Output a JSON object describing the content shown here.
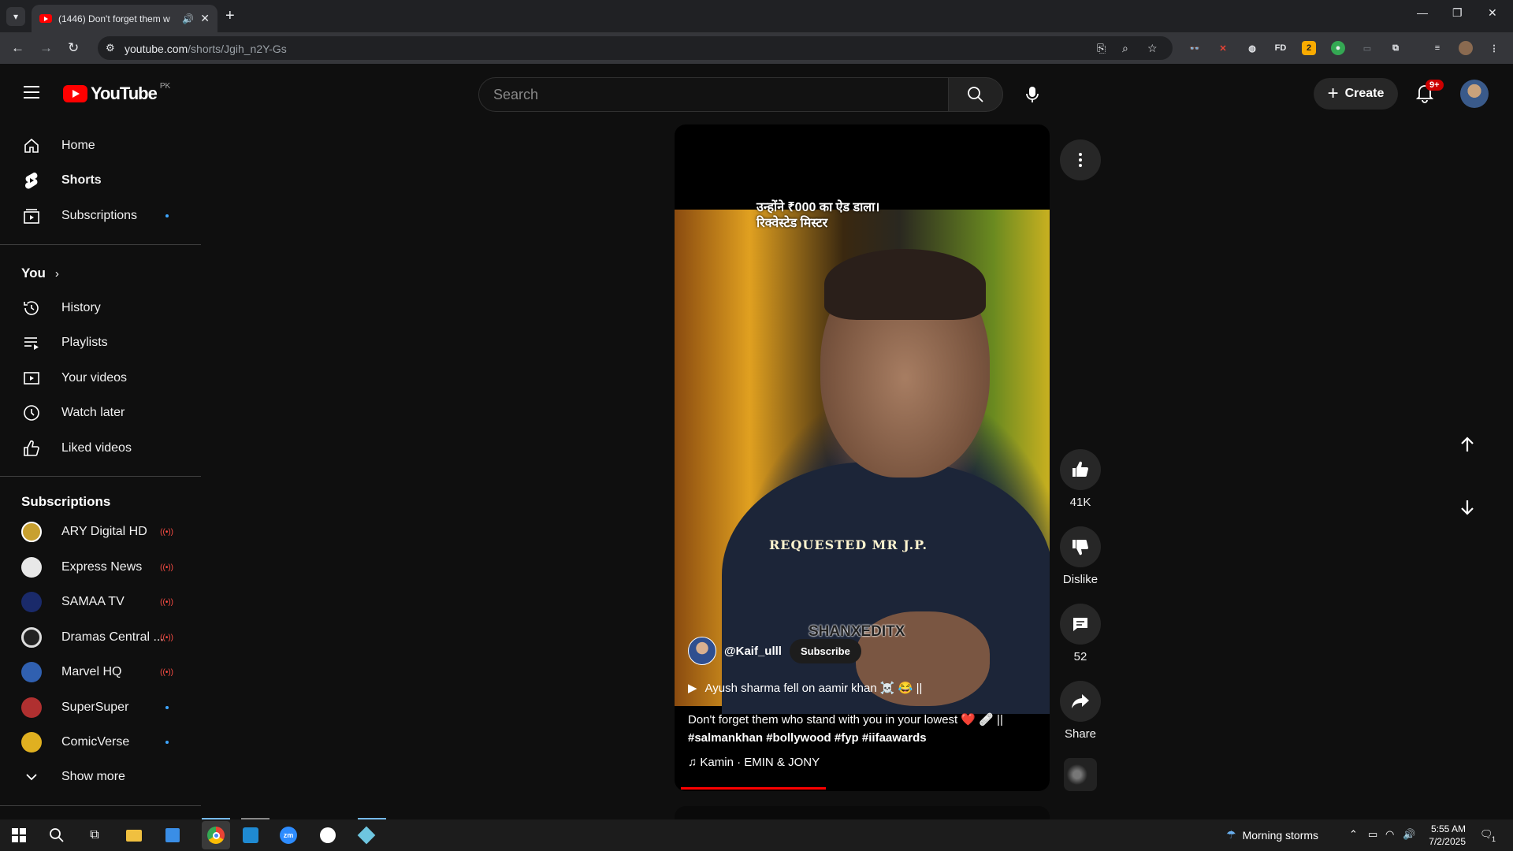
{
  "browser": {
    "tab_title": "(1446) Don't forget them w",
    "url_host": "youtube.com",
    "url_path": "/shorts/Jgih_n2Y-Gs"
  },
  "header": {
    "logo_text": "YouTube",
    "country_code": "PK",
    "search_placeholder": "Search",
    "create_label": "Create",
    "notification_count": "9+"
  },
  "sidebar": {
    "main": [
      {
        "label": "Home",
        "icon": "home-icon"
      },
      {
        "label": "Shorts",
        "icon": "shorts-icon"
      },
      {
        "label": "Subscriptions",
        "icon": "subscriptions-icon"
      }
    ],
    "you_heading": "You",
    "you_items": [
      {
        "label": "History",
        "icon": "history-icon"
      },
      {
        "label": "Playlists",
        "icon": "playlists-icon"
      },
      {
        "label": "Your videos",
        "icon": "your-videos-icon"
      },
      {
        "label": "Watch later",
        "icon": "watch-later-icon"
      },
      {
        "label": "Liked videos",
        "icon": "liked-videos-icon"
      }
    ],
    "subs_heading": "Subscriptions",
    "subscriptions": [
      {
        "name": "ARY Digital HD",
        "status": "live",
        "color": "#c8a030"
      },
      {
        "name": "Express News",
        "status": "live",
        "color": "#e8e8e8"
      },
      {
        "name": "SAMAA TV",
        "status": "live",
        "color": "#1a2a6a"
      },
      {
        "name": "Dramas Central ...",
        "status": "live",
        "color": "#222222"
      },
      {
        "name": "Marvel HQ",
        "status": "live",
        "color": "#3060b0"
      },
      {
        "name": "SuperSuper",
        "status": "new",
        "color": "#b03030"
      },
      {
        "name": "ComicVerse",
        "status": "new",
        "color": "#e0b020"
      }
    ],
    "show_more": "Show more"
  },
  "short": {
    "overlay_hindi_line1": "उन्होंने ₹000 का ऐड डाला।",
    "overlay_hindi_line2": "रिक्वेस्टेड मिस्टर",
    "overlay_watermark": "REQUESTED MR J.P.",
    "overlay_brand": "SHANXEDITX",
    "channel": "@Kaif_ulll",
    "subscribe_label": "Subscribe",
    "playlist_title": "Ayush sharma fell on aamir khan ☠️ 😂 ||",
    "description": "Don't forget them who stand with you in your lowest ❤️ 🩹 ||",
    "hashtags": "#salmankhan #bollywood #fyp #iifaawards",
    "music": "Kamin · EMIN & JONY",
    "progress": 0.4
  },
  "actions": {
    "likes": "41K",
    "dislike_label": "Dislike",
    "comments": "52",
    "share_label": "Share"
  },
  "taskbar": {
    "weather": "Morning storms",
    "time": "5:55 AM",
    "date": "7/2/2025",
    "notification_count": "1"
  }
}
